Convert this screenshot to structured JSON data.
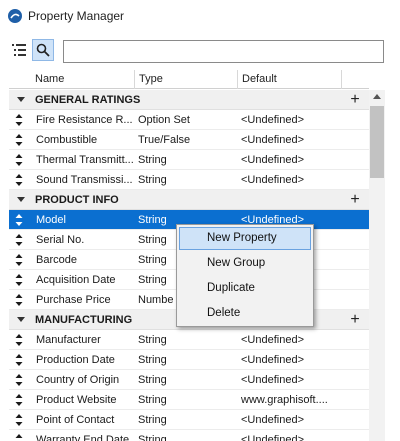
{
  "window": {
    "title": "Property Manager"
  },
  "toolbar": {
    "list_icon": "list-tree-icon",
    "search_icon": "search-icon",
    "search_value": "",
    "search_placeholder": ""
  },
  "table": {
    "columns": {
      "name": "Name",
      "type": "Type",
      "default": "Default"
    },
    "groups": [
      {
        "label": "GENERAL RATINGS",
        "rows": [
          {
            "name": "Fire Resistance R...",
            "type": "Option Set",
            "default": "<Undefined>"
          },
          {
            "name": "Combustible",
            "type": "True/False",
            "default": "<Undefined>"
          },
          {
            "name": "Thermal Transmitt...",
            "type": "String",
            "default": "<Undefined>"
          },
          {
            "name": "Sound Transmissi...",
            "type": "String",
            "default": "<Undefined>"
          }
        ]
      },
      {
        "label": "PRODUCT INFO",
        "rows": [
          {
            "name": "Model",
            "type": "String",
            "default": "<Undefined>"
          },
          {
            "name": "Serial No.",
            "type": "String",
            "default": ""
          },
          {
            "name": "Barcode",
            "type": "String",
            "default": ""
          },
          {
            "name": "Acquisition Date",
            "type": "String",
            "default": ""
          },
          {
            "name": "Purchase Price",
            "type": "Numbe",
            "default": ""
          }
        ]
      },
      {
        "label": "MANUFACTURING",
        "rows": [
          {
            "name": "Manufacturer",
            "type": "String",
            "default": "<Undefined>"
          },
          {
            "name": "Production Date",
            "type": "String",
            "default": "<Undefined>"
          },
          {
            "name": "Country of Origin",
            "type": "String",
            "default": "<Undefined>"
          },
          {
            "name": "Product Website",
            "type": "String",
            "default": "www.graphisoft...."
          },
          {
            "name": "Point of Contact",
            "type": "String",
            "default": "<Undefined>"
          },
          {
            "name": "Warranty End Date",
            "type": "String",
            "default": "<Undefined>"
          }
        ]
      }
    ]
  },
  "context_menu": {
    "items": [
      "New Property",
      "New Group",
      "Duplicate",
      "Delete"
    ]
  },
  "colors": {
    "selection": "#0b6fd0",
    "menu_highlight": "#cfe3f8",
    "group_bg": "#f0f0f0"
  }
}
